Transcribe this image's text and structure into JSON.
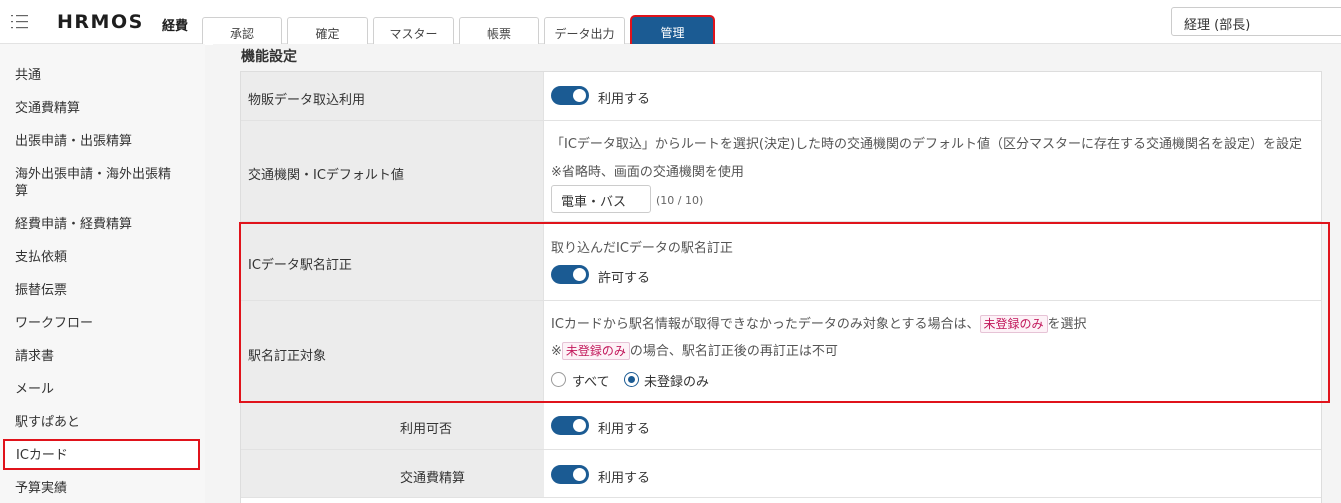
{
  "header": {
    "logo": "HRMOS",
    "logo_sub": "経費",
    "tabs": [
      "承認",
      "確定",
      "マスター",
      "帳票",
      "データ出力",
      "管理"
    ],
    "active_tab": "管理",
    "role": "経理 (部長)"
  },
  "sidebar": {
    "items": [
      "共通",
      "交通費精算",
      "出張申請・出張精算",
      "海外出張申請・海外出張精算",
      "経費申請・経費精算",
      "支払依頼",
      "振替伝票",
      "ワークフロー",
      "請求書",
      "メール",
      "駅すぱあと",
      "ICカード",
      "予算実績"
    ],
    "selected": "ICカード"
  },
  "main": {
    "section_title": "機能設定",
    "rows": {
      "bussan": {
        "label": "物販データ取込利用",
        "toggle_label": "利用する"
      },
      "default_transport": {
        "label": "交通機関・ICデフォルト値",
        "note1": "「ICデータ取込」からルートを選択(決定)した時の交通機関のデフォルト値（区分マスターに存在する交通機関名を設定）を設定",
        "note2": "※省略時、画面の交通機関を使用",
        "input_value": "電車・バス",
        "counter": "(10 / 10)"
      },
      "station_fix": {
        "label": "ICデータ駅名訂正",
        "note": "取り込んだICデータの駅名訂正",
        "toggle_label": "許可する"
      },
      "station_fix_target": {
        "label": "駅名訂正対象",
        "note1_pre": "ICカードから駅名情報が取得できなかったデータのみ対象とする場合は、",
        "note1_tag": "未登録のみ",
        "note1_post": "を選択",
        "note2_pre": "※",
        "note2_tag": "未登録のみ",
        "note2_post": "の場合、駅名訂正後の再訂正は不可",
        "option_all": "すべて",
        "option_unregistered": "未登録のみ"
      },
      "usage": {
        "label": "利用可否",
        "toggle_label": "利用する"
      },
      "transport_expense": {
        "label": "交通費精算",
        "toggle_label": "利用する"
      }
    }
  }
}
